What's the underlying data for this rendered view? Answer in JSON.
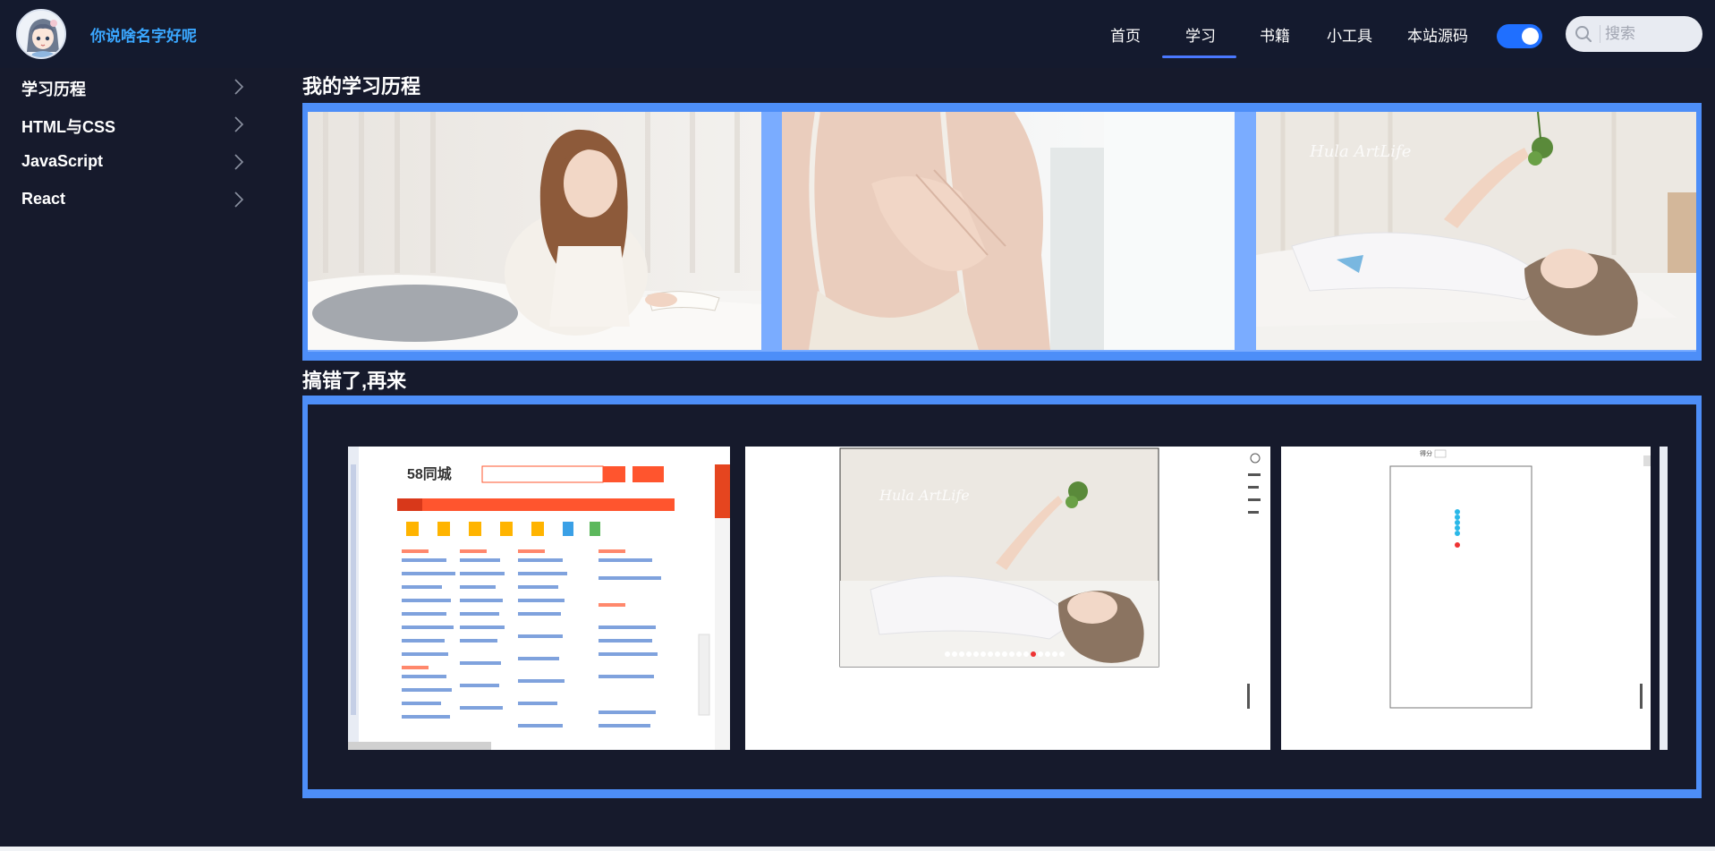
{
  "header": {
    "site_name": "你说啥名字好呢",
    "avatar_icon": "anime-girl-avatar-icon",
    "nav": [
      {
        "label": "首页",
        "active": false
      },
      {
        "label": "学习",
        "active": true
      },
      {
        "label": "书籍",
        "active": false
      },
      {
        "label": "小工具",
        "active": false
      },
      {
        "label": "本站源码",
        "active": false
      }
    ],
    "theme_toggle_on": true,
    "search": {
      "placeholder": "搜索",
      "value": "",
      "icon": "search-icon"
    }
  },
  "sidebar": {
    "items": [
      {
        "label": "学习历程",
        "icon": "chevron-right-icon"
      },
      {
        "label": "HTML与CSS",
        "icon": "chevron-right-icon"
      },
      {
        "label": "JavaScript",
        "icon": "chevron-right-icon"
      },
      {
        "label": "React",
        "icon": "chevron-right-icon"
      }
    ]
  },
  "main": {
    "section1_title": "我的学习历程",
    "section2_title": "搞错了,再来",
    "gallery1": [
      "photo-reading-girl",
      "photo-hand-closeup",
      "photo-lying-girl-with-flower"
    ],
    "gallery2": [
      "screenshot-58-tongcheng",
      "screenshot-image-carousel",
      "screenshot-snake-game"
    ],
    "shot1_logo": "58同城",
    "shot3_label": "得分"
  },
  "colors": {
    "background": "#161a2c",
    "accent": "#4d8ef8",
    "site_name": "#3aa7ff",
    "toggle": "#1f6fff"
  }
}
